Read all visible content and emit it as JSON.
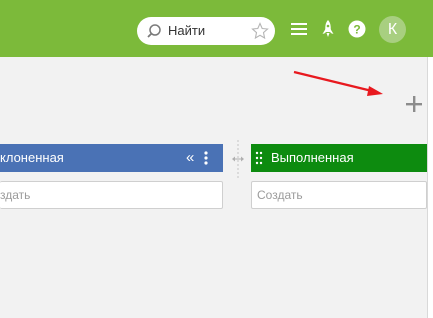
{
  "header": {
    "search_placeholder": "Найти",
    "avatar_initial": "К"
  },
  "board": {
    "columns": [
      {
        "title": "клоненная",
        "create_placeholder": "здать",
        "color": "#4a72b5"
      },
      {
        "title": "Выполненная",
        "create_placeholder": "Создать",
        "color": "#0d8b0f"
      }
    ]
  },
  "colors": {
    "topbar": "#7cba3a",
    "annotation_arrow": "#e8191f"
  },
  "icons": [
    "search-icon",
    "star-icon",
    "menu-icon",
    "rocket-icon",
    "help-icon",
    "add-column-icon",
    "collapse-icon",
    "kebab-menu-icon",
    "drag-handle-icon",
    "column-resize-icon"
  ]
}
